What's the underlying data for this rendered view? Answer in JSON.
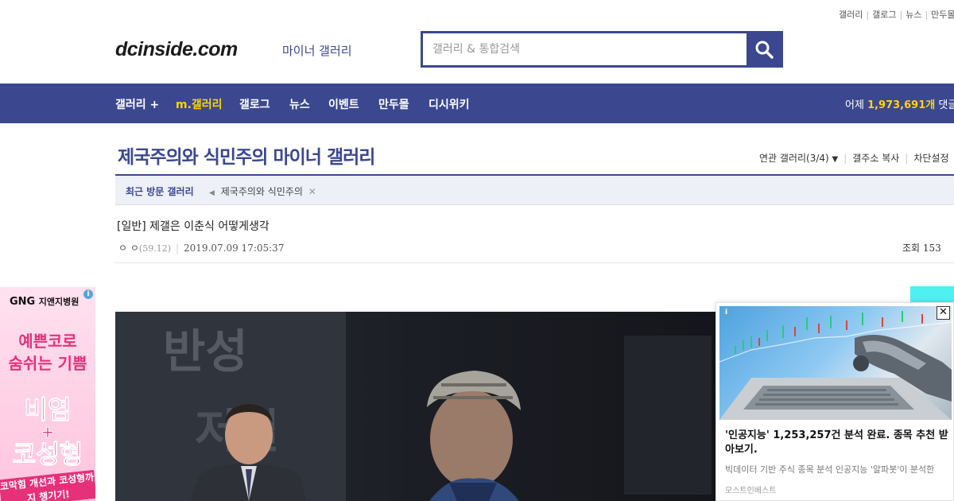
{
  "top_links": [
    "갤러리",
    "갤로그",
    "뉴스",
    "만두몰"
  ],
  "logo": {
    "main": "dcinside.com",
    "sub": "마이너 갤러리"
  },
  "search": {
    "placeholder": "갤러리 & 통합검색"
  },
  "nav": {
    "items": [
      "갤러리 +",
      "m.갤러리",
      "갤로그",
      "뉴스",
      "이벤트",
      "만두몰",
      "디시위키"
    ],
    "stat_prefix": "어제",
    "stat_value": "1,973,691개",
    "stat_suffix": "댓글"
  },
  "gallery": {
    "title": "제국주의와 식민주의 마이너 갤러리",
    "tools": [
      "연관 갤러리(3/4)",
      "갤주소 복사",
      "차단설정"
    ]
  },
  "recent": {
    "label": "최근 방문 갤러리",
    "items": [
      "제국주의와 식민주의"
    ]
  },
  "post": {
    "title": "[일반] 제갤은 이춘식 어떻게생각",
    "author": "ㅇ ㅇ",
    "ip": "(59.12)",
    "date": "2019.07.09 17:05:37",
    "views_label": "조회 153"
  },
  "side_ad": {
    "brand": "GNG",
    "brand_sub": "지앤지병원",
    "line1": "예쁜코로",
    "line2": "숨쉬는 기쁨",
    "line3": "비염",
    "plus": "+",
    "line4": "코성형",
    "line5": "코막힘 개선과 코성형까지 챙기기!"
  },
  "video": {
    "bg_text_1": "반성",
    "bg_text_2": "저질"
  },
  "native_ad": {
    "headline": "'인공지능' 1,253,257건 분석 완료. 종목 추천 받아보기.",
    "desc": "빅데이터 기반 주식 종목 분석 인공지능 '알파봇'이 분석한",
    "source": "모스트인베스트"
  },
  "colors": {
    "brand": "#3b4890",
    "highlight": "#ffd500",
    "ad_pink": "#e6307a"
  }
}
